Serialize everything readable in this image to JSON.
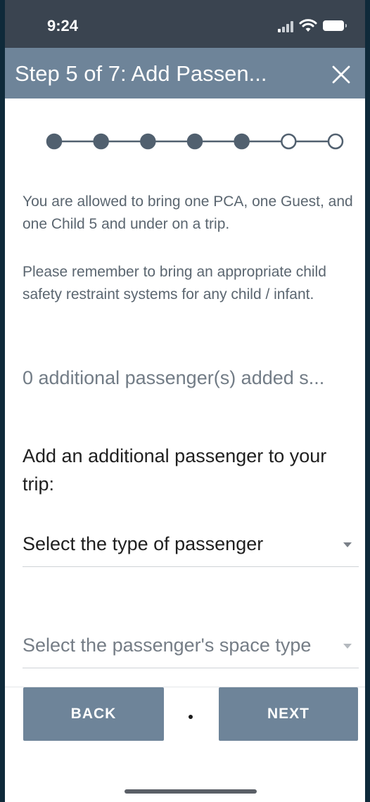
{
  "status_bar": {
    "time": "9:24",
    "signal_icon": "cellular-signal-icon",
    "wifi_icon": "wifi-icon",
    "battery_icon": "battery-icon"
  },
  "header": {
    "title": "Step 5 of 7: Add Passen...",
    "close_icon": "close-icon",
    "background_color": "#6e8499"
  },
  "stepper": {
    "total_steps": 7,
    "current_step": 5,
    "filled_color": "#51606f"
  },
  "info": {
    "allowance_text": "You are allowed to bring one PCA, one Guest, and one Child 5 and under on a trip.",
    "safety_text": "Please remember to bring an appropriate child safety restraint systems for any child / infant."
  },
  "passenger_count_text": "0 additional passenger(s) added s...",
  "add_prompt": "Add an additional passenger to your trip:",
  "fields": {
    "passenger_type": {
      "value": "Select the type of passenger",
      "icon": "dropdown-caret-icon"
    },
    "space_type": {
      "value": "Select the passenger's space type",
      "icon": "dropdown-caret-icon"
    }
  },
  "footer": {
    "back_label": "BACK",
    "next_label": "NEXT",
    "button_color": "#6e8499"
  }
}
